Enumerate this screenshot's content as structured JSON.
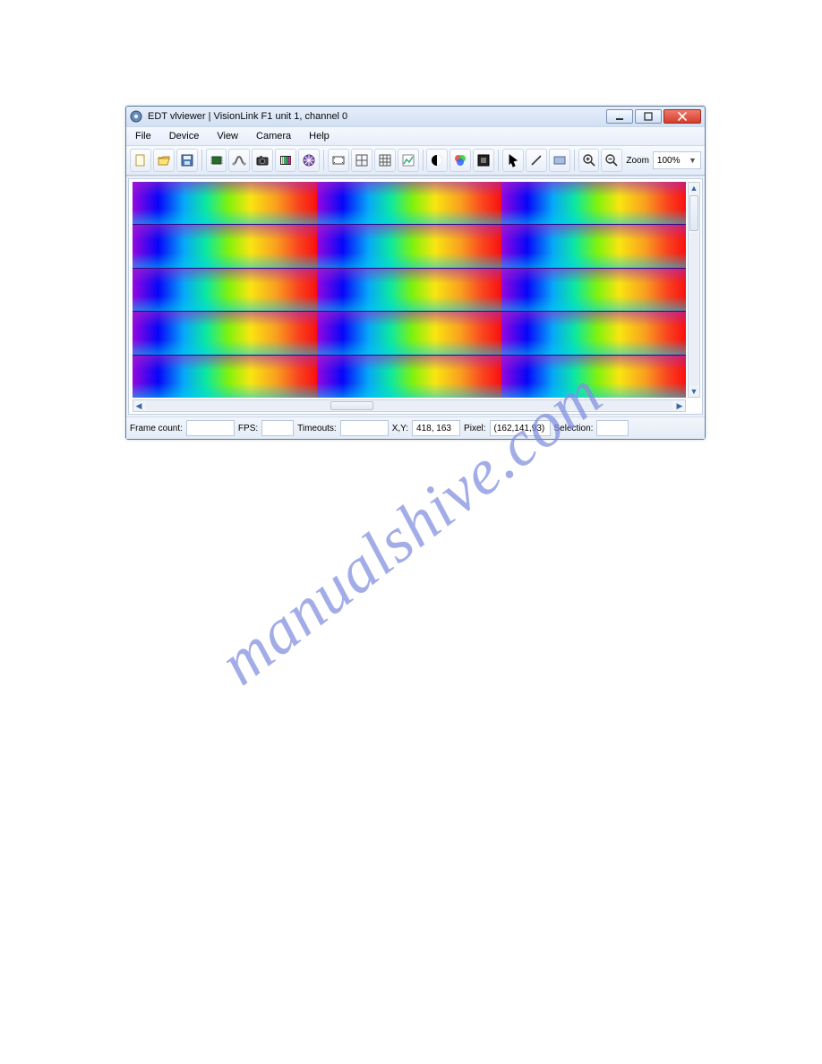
{
  "window": {
    "title": "EDT vlviewer | VisionLink F1 unit 1, channel 0"
  },
  "menu": {
    "file": "File",
    "device": "Device",
    "view": "View",
    "camera": "Camera",
    "help": "Help"
  },
  "toolbar": {
    "icons": [
      "new-file-icon",
      "open-folder-icon",
      "save-icon",
      "chip-icon",
      "cable-icon",
      "camera-icon",
      "bars-icon",
      "aperture-icon",
      "film-icon",
      "grid-icon",
      "grid2-icon",
      "chart-icon",
      "contrast-icon",
      "color-icon",
      "fullscreen-icon",
      "pointer-icon",
      "line-icon",
      "rect-icon",
      "zoom-in-icon",
      "zoom-out-icon"
    ],
    "zoom_label": "Zoom",
    "zoom_value": "100%"
  },
  "status": {
    "frame_count_label": "Frame count:",
    "frame_count_value": "",
    "fps_label": "FPS:",
    "fps_value": "",
    "timeouts_label": "Timeouts:",
    "timeouts_value": "",
    "xy_label": "X,Y:",
    "xy_value": "418, 163",
    "pixel_label": "Pixel:",
    "pixel_value": "(162,141,93)",
    "selection_label": "Selection:",
    "selection_value": ""
  },
  "watermark": "manualshive.com"
}
